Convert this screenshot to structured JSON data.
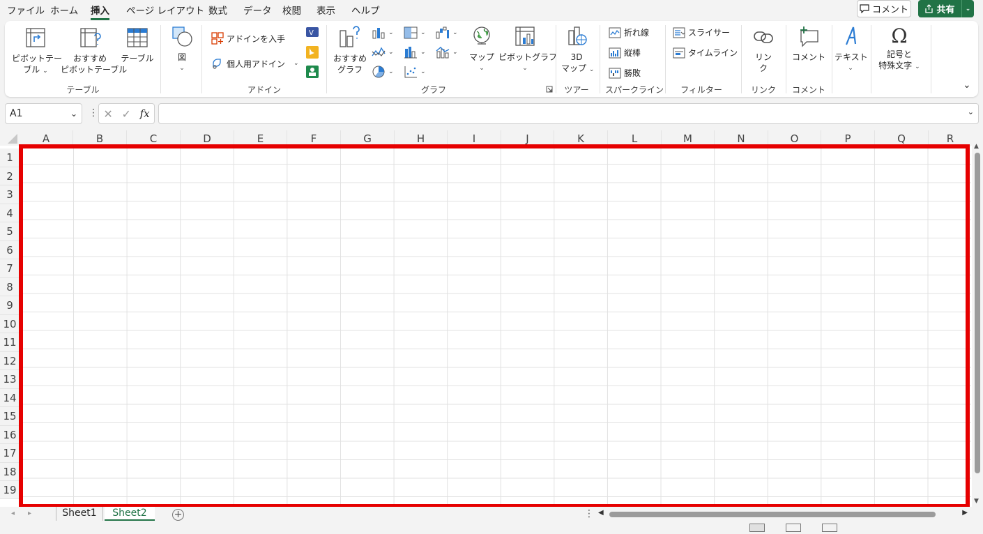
{
  "menu": {
    "tabs": [
      "ファイル",
      "ホーム",
      "挿入",
      "ページ レイアウト",
      "数式",
      "データ",
      "校閲",
      "表示",
      "ヘルプ"
    ],
    "active": "挿入",
    "comment_label": "コメント",
    "share_label": "共有"
  },
  "ribbon": {
    "groups": {
      "table": "テーブル",
      "addin": "アドイン",
      "graph": "グラフ",
      "tour": "ツアー",
      "sparkline": "スパークライン",
      "filter": "フィルター",
      "link": "リンク",
      "comment": "コメント"
    },
    "buttons": {
      "pivot_table_1": "ピボットテー",
      "pivot_table_2": "ブル",
      "rec_pivot_1": "おすすめ",
      "rec_pivot_2": "ピボットテーブル",
      "table": "テーブル",
      "illustration": "図",
      "get_addin": "アドインを入手",
      "my_addin": "個人用アドイン",
      "rec_chart_1": "おすすめ",
      "rec_chart_2": "グラフ",
      "map": "マップ",
      "pivot_chart": "ピボットグラフ",
      "map3d_1": "3D",
      "map3d_2": "マップ",
      "spark_line": "折れ線",
      "spark_column": "縦棒",
      "spark_winloss": "勝敗",
      "slicer": "スライサー",
      "timeline": "タイムライン",
      "link_1": "リン",
      "link_2": "ク",
      "comment": "コメント",
      "text": "テキスト",
      "symbol_1": "記号と",
      "symbol_2": "特殊文字"
    }
  },
  "formula_bar": {
    "name_box": "A1",
    "fx": "fx",
    "value": ""
  },
  "grid": {
    "columns": [
      "A",
      "B",
      "C",
      "D",
      "E",
      "F",
      "G",
      "H",
      "I",
      "J",
      "K",
      "L",
      "M",
      "N",
      "O",
      "P",
      "Q",
      "R"
    ],
    "rows": [
      "1",
      "2",
      "3",
      "4",
      "5",
      "6",
      "7",
      "8",
      "9",
      "10",
      "11",
      "12",
      "13",
      "14",
      "15",
      "16",
      "17",
      "18",
      "19"
    ]
  },
  "sheets": {
    "tabs": [
      "Sheet1",
      "Sheet2"
    ],
    "active": "Sheet2",
    "add_label": "+"
  },
  "colors": {
    "accent": "#217346",
    "highlight": "#e60000"
  }
}
